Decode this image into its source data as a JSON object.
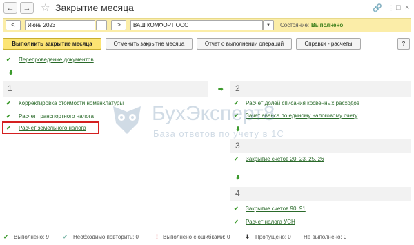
{
  "window": {
    "title": "Закрытие месяца"
  },
  "period": {
    "month": "Июнь 2023",
    "prev": "<",
    "next": ">",
    "dots": "...",
    "org": "ВАШ КОМФОРТ ООО",
    "status_label": "Состояние:",
    "status_value": "Выполнено"
  },
  "actions": {
    "run": "Выполнить закрытие месяца",
    "cancel": "Отменить закрытие месяца",
    "report": "Отчет о выполнении операций",
    "refs": "Справки - расчеты",
    "help": "?"
  },
  "top_item": {
    "label": "Перепроведение документов"
  },
  "groups": [
    {
      "num": "1",
      "items": [
        {
          "label": "Корректировка стоимости номенклатуры"
        },
        {
          "label": "Расчет транспортного налога"
        },
        {
          "label": "Расчет земельного налога"
        }
      ]
    },
    {
      "num": "2",
      "items": [
        {
          "label": "Расчет долей списания косвенных расходов"
        },
        {
          "label": "Зачет аванса по единому налоговому счету"
        }
      ]
    },
    {
      "num": "3",
      "items": [
        {
          "label": "Закрытие счетов 20, 23, 25, 26"
        }
      ]
    },
    {
      "num": "4",
      "items": [
        {
          "label": "Закрытие счетов 90, 91"
        },
        {
          "label": "Расчет налога УСН"
        }
      ]
    }
  ],
  "watermark": {
    "title": "БухЭксперт8",
    "subtitle": "База ответов по учету в 1С"
  },
  "footer": {
    "done": "Выполнено: 9",
    "repeat": "Необходимо повторить: 0",
    "errors": "Выполнено с ошибками: 0",
    "skipped": "Пропущено: 0",
    "not_done": "Не выполнено: 0"
  }
}
